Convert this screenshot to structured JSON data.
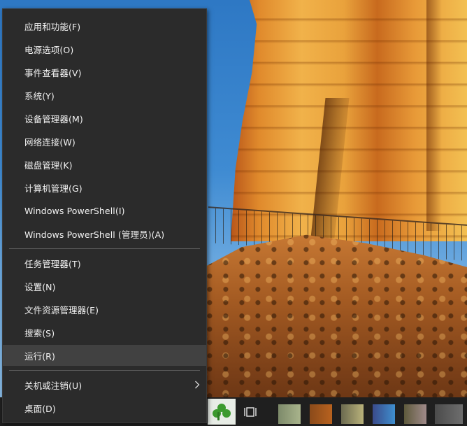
{
  "context_menu": {
    "items": [
      {
        "label": "应用和功能(F)"
      },
      {
        "label": "电源选项(O)"
      },
      {
        "label": "事件查看器(V)"
      },
      {
        "label": "系统(Y)"
      },
      {
        "label": "设备管理器(M)"
      },
      {
        "label": "网络连接(W)"
      },
      {
        "label": "磁盘管理(K)"
      },
      {
        "label": "计算机管理(G)"
      },
      {
        "label": "Windows PowerShell(I)"
      },
      {
        "label": "Windows PowerShell (管理员)(A)"
      },
      {
        "label": "任务管理器(T)"
      },
      {
        "label": "设置(N)"
      },
      {
        "label": "文件资源管理器(E)"
      },
      {
        "label": "搜索(S)"
      },
      {
        "label": "运行(R)",
        "highlighted": true
      },
      {
        "label": "关机或注销(U)",
        "has_submenu": true,
        "submenu_icon": "chevron-right-icon"
      },
      {
        "label": "桌面(D)"
      }
    ]
  },
  "taskbar": {
    "pinned_app_icon": "clover-app-icon",
    "task_view_icon": "task-view-icon"
  },
  "colors": {
    "menu_bg": "#2b2b2b",
    "menu_text": "#f2f2f2",
    "menu_highlight": "#414141",
    "separator": "#5c5c5c",
    "taskbar_bg": "#1f1f1f"
  }
}
